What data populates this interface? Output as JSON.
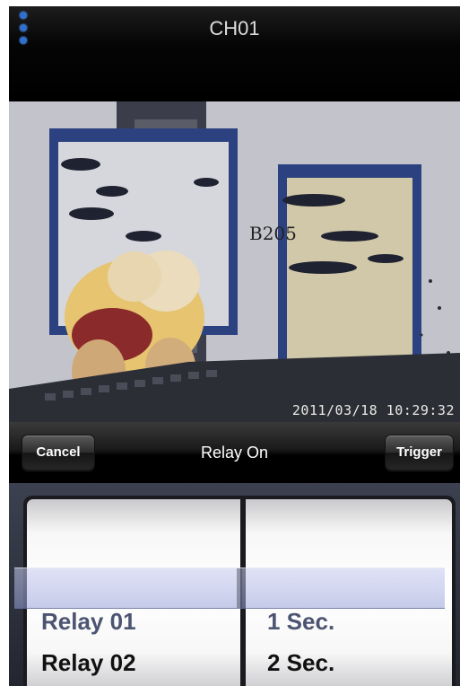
{
  "header": {
    "channel_title": "CH01",
    "menu_icon": "vertical-dots-icon",
    "menu_icon_color": "#2f6fd0"
  },
  "video": {
    "sign_text": "B205",
    "timestamp": "2011/03/18 10:29:32"
  },
  "toolbar": {
    "cancel_label": "Cancel",
    "title": "Relay On",
    "trigger_label": "Trigger"
  },
  "picker": {
    "relay_column": [
      "Relay 01",
      "Relay 02"
    ],
    "duration_column": [
      "1 Sec.",
      "2 Sec."
    ],
    "selected_relay": "Relay 01",
    "selected_duration": "1 Sec."
  }
}
